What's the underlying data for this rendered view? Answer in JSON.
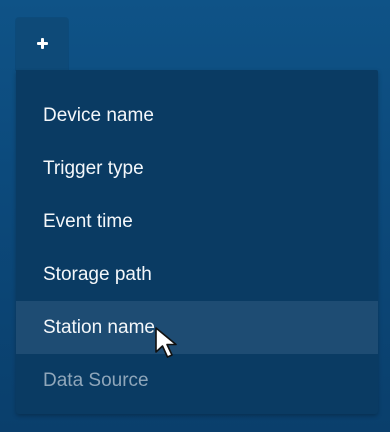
{
  "add_button": {
    "icon": "plus-icon"
  },
  "menu": {
    "items": [
      {
        "label": "Device name",
        "state": "normal"
      },
      {
        "label": "Trigger type",
        "state": "normal"
      },
      {
        "label": "Event time",
        "state": "normal"
      },
      {
        "label": "Storage path",
        "state": "normal"
      },
      {
        "label": "Station name",
        "state": "hovered"
      },
      {
        "label": "Data Source",
        "state": "dimmed"
      }
    ]
  },
  "colors": {
    "background": "#0c4a7c",
    "menu_background": "#0a3b63",
    "hover_background": "#1e4c73",
    "text": "#f4f7fa",
    "dim_text": "#8fa6ba"
  },
  "pointer": {
    "icon": "mouse-cursor-icon"
  }
}
